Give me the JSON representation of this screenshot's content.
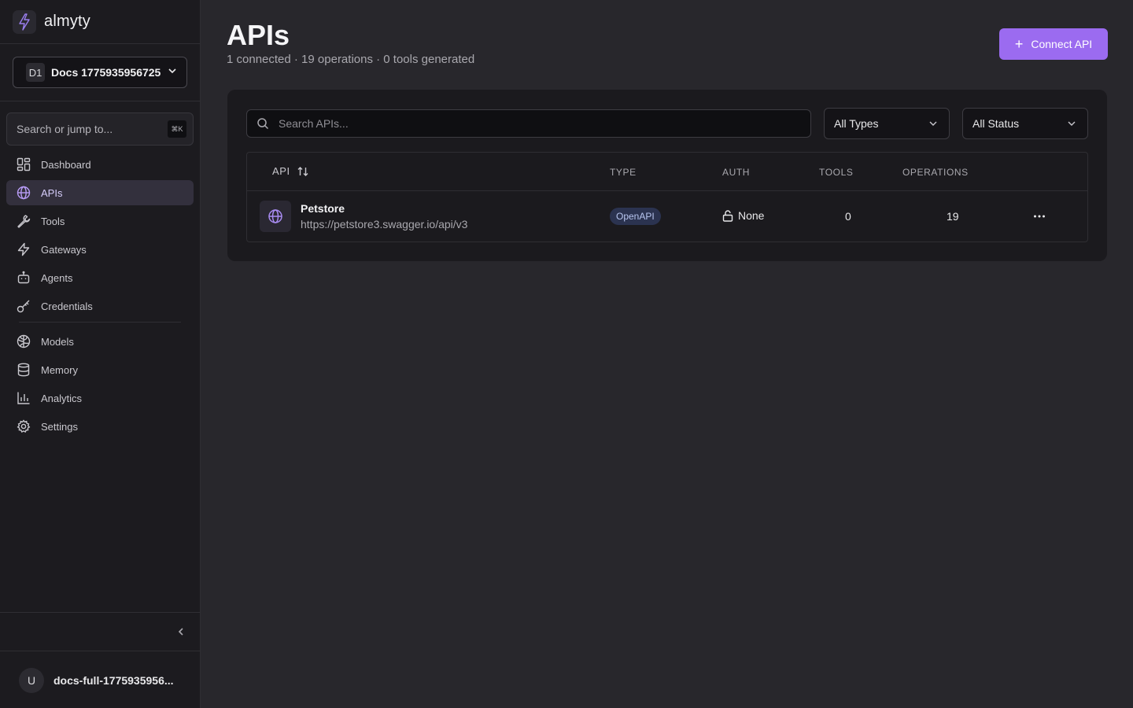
{
  "app": {
    "name": "almyty"
  },
  "workspace": {
    "badge": "D1",
    "name": "Docs 1775935956725"
  },
  "sidebar": {
    "search_placeholder": "Search or jump to...",
    "search_shortcut": "⌘K",
    "items": [
      {
        "label": "Dashboard",
        "icon": "dashboard-icon"
      },
      {
        "label": "APIs",
        "icon": "globe-icon",
        "active": true
      },
      {
        "label": "Tools",
        "icon": "wrench-icon"
      },
      {
        "label": "Gateways",
        "icon": "bolt-icon"
      },
      {
        "label": "Agents",
        "icon": "robot-icon"
      },
      {
        "label": "Credentials",
        "icon": "key-icon"
      },
      {
        "label": "Models",
        "icon": "brain-icon"
      },
      {
        "label": "Memory",
        "icon": "database-icon"
      },
      {
        "label": "Analytics",
        "icon": "bar-chart-icon"
      },
      {
        "label": "Settings",
        "icon": "gear-icon"
      }
    ]
  },
  "user": {
    "initial": "U",
    "name": "docs-full-1775935956..."
  },
  "page": {
    "title": "APIs",
    "subtitle": "1 connected · 19 operations · 0 tools generated",
    "connect_button": "Connect API"
  },
  "filters": {
    "search_placeholder": "Search APIs...",
    "type": "All Types",
    "status": "All Status"
  },
  "table": {
    "columns": {
      "api": "API",
      "type": "TYPE",
      "auth": "AUTH",
      "tools": "TOOLS",
      "operations": "OPERATIONS"
    },
    "rows": [
      {
        "name": "Petstore",
        "url": "https://petstore3.swagger.io/api/v3",
        "type": "OpenAPI",
        "auth": "None",
        "tools": "0",
        "operations": "19"
      }
    ]
  },
  "colors": {
    "accent": "#9b6bf0",
    "background": "#28272c",
    "sidebar": "#1c1b1f",
    "panel": "#1b1a1e"
  }
}
